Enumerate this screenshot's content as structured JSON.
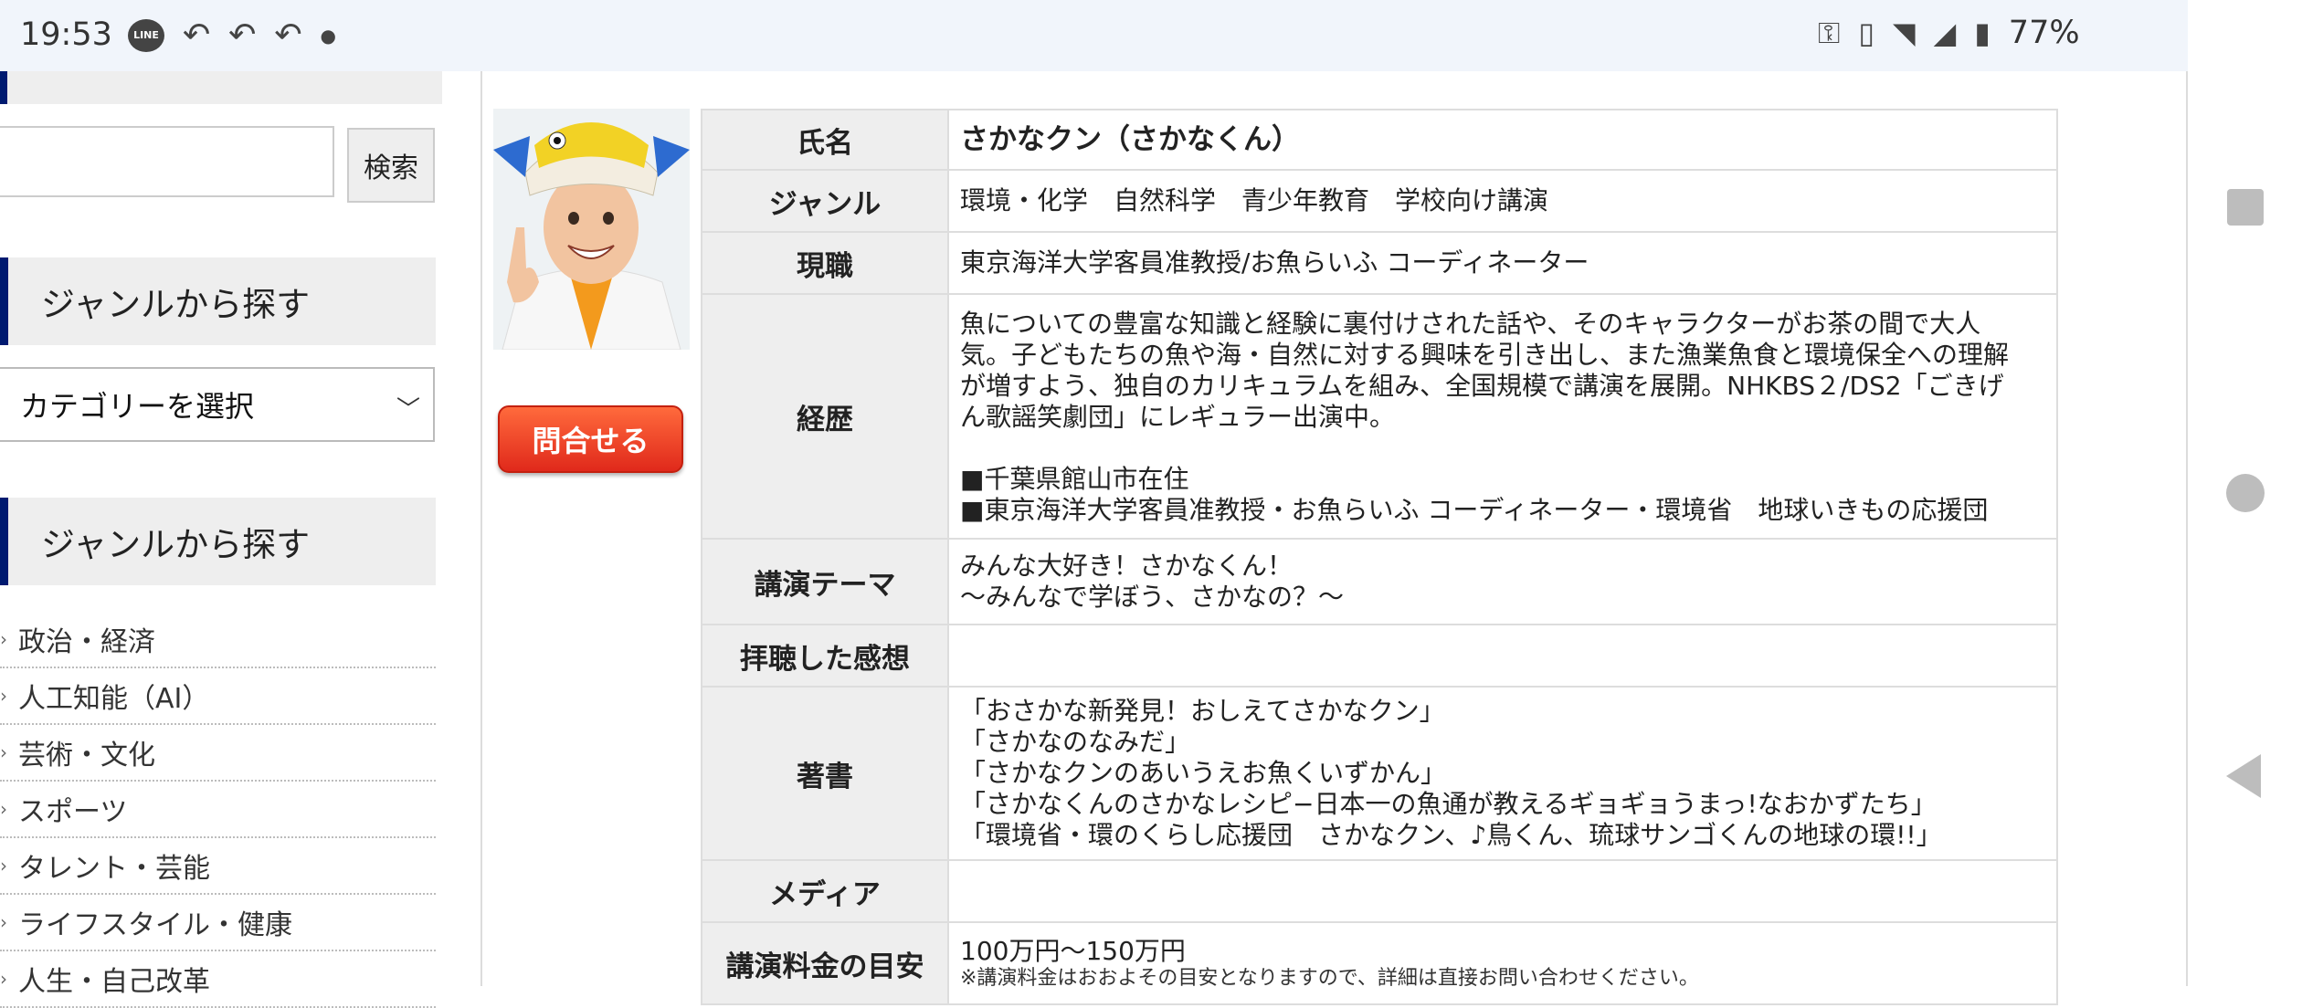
{
  "status_bar": {
    "time": "19:53",
    "battery": "77%",
    "icons_left": [
      "line-app-icon",
      "reply-arrow-icon",
      "reply-arrow-icon",
      "reply-arrow-icon",
      "dot-icon"
    ],
    "icons_right": [
      "key-icon",
      "vibrate-icon",
      "wifi-icon",
      "signal-icon",
      "battery-icon"
    ]
  },
  "sidebar": {
    "search_button": "検索",
    "genre_heading_1": "ジャンルから探す",
    "category_select": "カテゴリーを選択",
    "genre_heading_2": "ジャンルから探す",
    "genres": [
      "政治・経済",
      "人工知能（AI）",
      "芸術・文化",
      "スポーツ",
      "タレント・芸能",
      "ライフスタイル・健康",
      "人生・自己改革"
    ]
  },
  "profile": {
    "contact_button": "問合せる",
    "rows": {
      "name_label": "氏名",
      "name_value": "さかなクン（さかなくん）",
      "genre_label": "ジャンル",
      "genre_value": "環境・化学　自然科学　青少年教育　学校向け講演",
      "job_label": "現職",
      "job_value": "東京海洋大学客員准教授/お魚らいふ コーディネーター",
      "career_label": "経歴",
      "career_lines": [
        "魚についての豊富な知識と経験に裏付けされた話や、そのキャラクターがお茶の間で大人",
        "気。子どもたちの魚や海・自然に対する興味を引き出し、また漁業魚食と環境保全への理解",
        "が増すよう、独自のカリキュラムを組み、全国規模で講演を展開。NHKBS２/DS2「ごきげ",
        "ん歌謡笑劇団」にレギュラー出演中。",
        "",
        "■千葉県館山市在住",
        "■東京海洋大学客員准教授・お魚らいふ コーディネーター・環境省　地球いきもの応援団"
      ],
      "theme_label": "講演テーマ",
      "theme_lines": [
        "みんな大好き！さかなくん！",
        "〜みんなで学ぼう、さかなの？〜"
      ],
      "feedback_label": "拝聴した感想",
      "books_label": "著書",
      "books": [
        "「おさかな新発見！おしえてさかなクン」",
        "「さかなのなみだ」",
        "「さかなクンのあいうえお魚くいずかん」",
        "「さかなくんのさかなレシピ−日本一の魚通が教えるギョギョうまっ!なおかずたち」",
        "「環境省・環のくらし応援団　さかなクン、♪鳥くん、琉球サンゴくんの地球の環!!」"
      ],
      "media_label": "メディア",
      "fee_label": "講演料金の目安",
      "fee_value": "100万円〜150万円",
      "fee_note": "※講演料金はおおよその目安となりますので、詳細は直接お問い合わせください。"
    }
  }
}
